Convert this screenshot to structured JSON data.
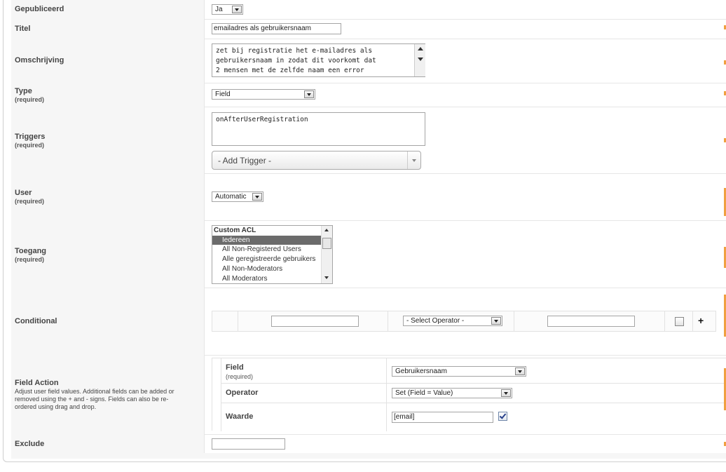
{
  "published": {
    "label": "Gepubliceerd",
    "value": "Ja"
  },
  "title": {
    "label": "Titel",
    "value": "emailadres als gebruikersnaam"
  },
  "description": {
    "label": "Omschrijving",
    "lines": [
      "zet bij registratie het e-mailadres als",
      "gebruikersnaam in zodat dit voorkomt dat",
      "2 mensen met de zelfde naam een error"
    ]
  },
  "type": {
    "label": "Type",
    "required": "(required)",
    "value": "Field"
  },
  "triggers": {
    "label": "Triggers",
    "required": "(required)",
    "value": "onAfterUserRegistration",
    "add_placeholder": "- Add Trigger -"
  },
  "user": {
    "label": "User",
    "required": "(required)",
    "value": "Automatic"
  },
  "access": {
    "label": "Toegang",
    "required": "(required)",
    "group": "Custom ACL",
    "options": [
      "Iedereen",
      "All Non-Registered Users",
      "Alle geregistreerde gebruikers",
      "All Non-Moderators",
      "All Moderators"
    ],
    "selected": "Iedereen"
  },
  "conditional": {
    "label": "Conditional",
    "operator_placeholder": "- Select Operator -",
    "add_symbol": "+"
  },
  "field_action": {
    "label": "Field Action",
    "desc": [
      "Adjust user field values. Additional fields can be added or",
      "removed using the + and - signs. Fields can also be re-",
      "ordered using drag and drop."
    ],
    "field_label": "Field",
    "field_required": "(required)",
    "field_value": "Gebruikersnaam",
    "operator_label": "Operator",
    "operator_value": "Set (Field = Value)",
    "value_label": "Waarde",
    "value_value": "[email]",
    "value_checked": true
  },
  "exclude": {
    "label": "Exclude"
  },
  "colors": {
    "accent_orange": "#f0a040",
    "selected_bg": "#6b6b6b"
  }
}
